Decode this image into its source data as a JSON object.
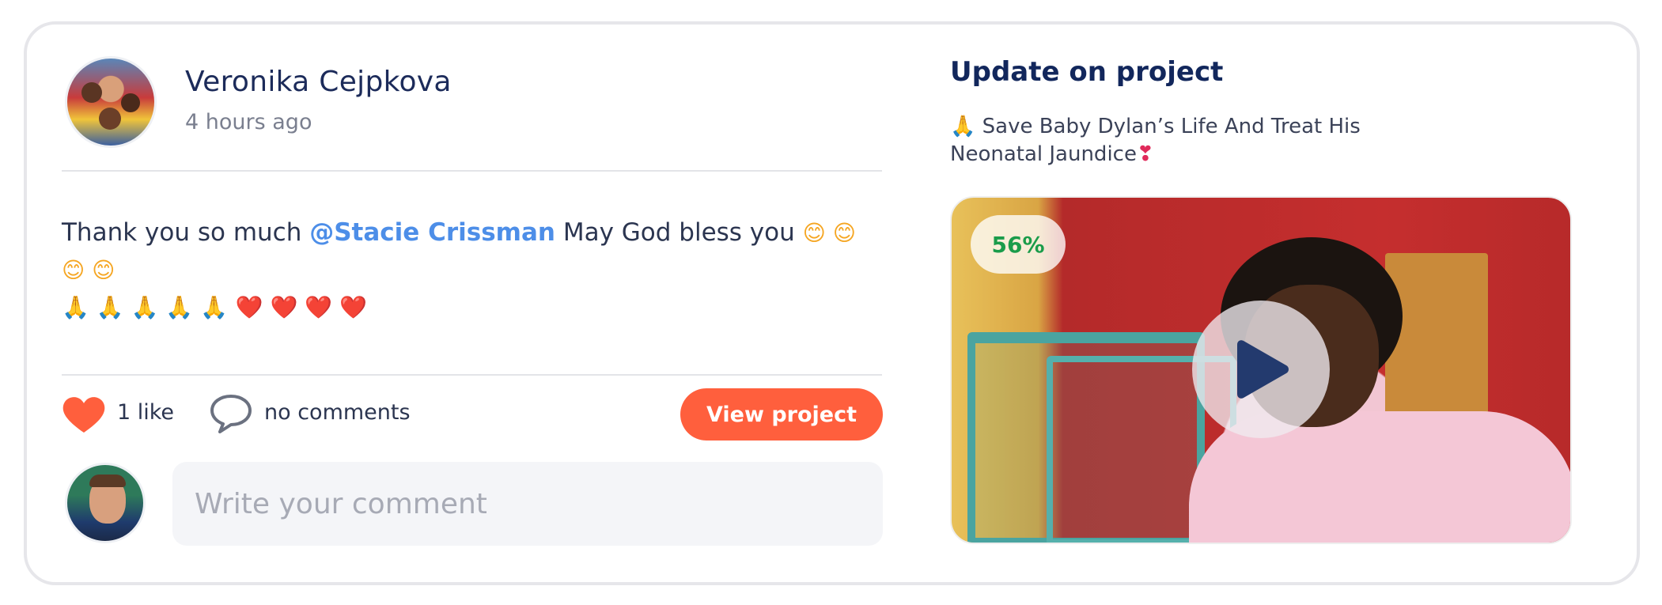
{
  "post": {
    "author_name": "Veronika Cejpkova",
    "time_ago": "4 hours ago",
    "message": {
      "before_mention": "Thank you so much ",
      "mention": "@Stacie Crissman",
      "after_mention": " May God bless you ",
      "emojis_line1": "😊 😊 😊 😊",
      "emojis_line2_pray": "🙏 🙏 🙏 🙏 🙏",
      "emojis_line2_hearts": "❤️ ❤️ ❤️ ❤️"
    },
    "likes_label": "1 like",
    "comments_label": "no comments",
    "view_project_label": "View project",
    "comment_placeholder": "Write your comment"
  },
  "update": {
    "heading": "Update on project",
    "project_title_prefix_emoji": "🙏",
    "project_title": "Save Baby Dylan’s Life And Treat His Neonatal Jaundice",
    "project_title_suffix_emoji": "❣",
    "progress_label": "56%",
    "progress_fraction": 0.56
  },
  "colors": {
    "accent": "#ff5f3d",
    "title": "#12275c",
    "mention": "#4d8ee8",
    "progress": "#1a9c4a"
  },
  "icons": {
    "like": "heart-icon",
    "comment": "speech-bubble-icon",
    "play": "play-icon"
  }
}
